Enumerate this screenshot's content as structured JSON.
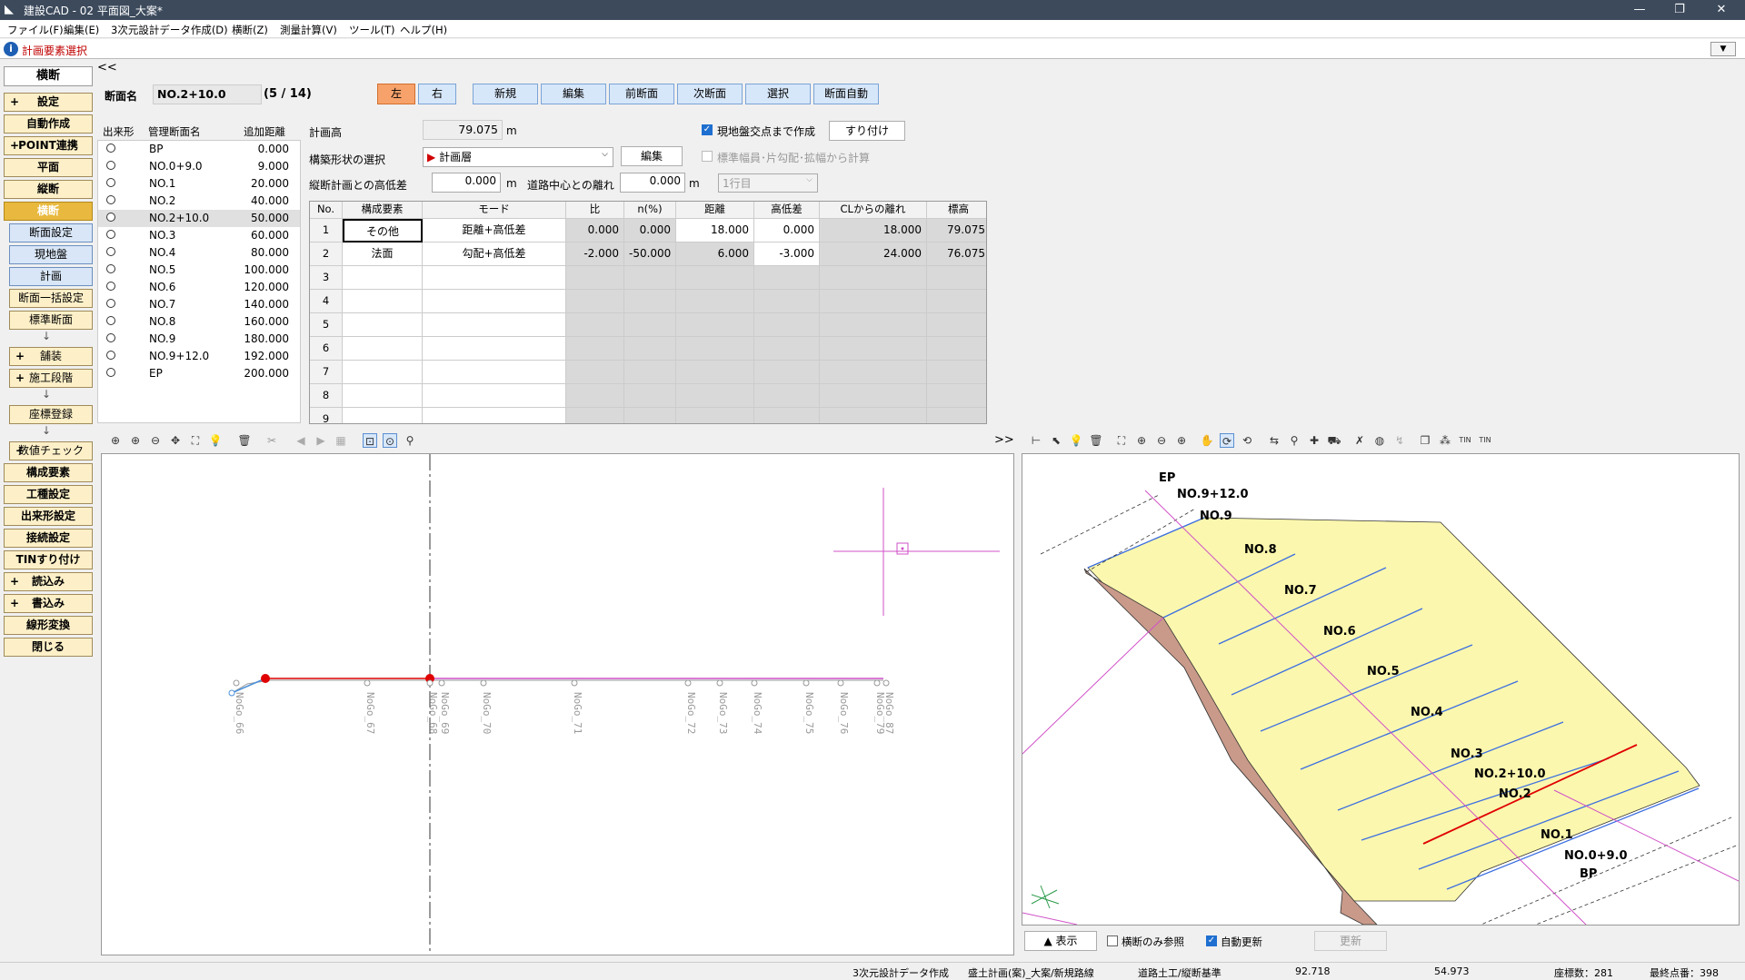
{
  "window": {
    "title": "建設CAD - 02 平面図_大案*",
    "minimize": "—",
    "restore": "❐",
    "close": "✕"
  },
  "menu": [
    "ファイル(F)",
    "編集(E)",
    "3次元設計データ作成(D)",
    "横断(Z)",
    "測量計算(V)",
    "ツール(T)",
    "ヘルプ(H)"
  ],
  "panel": {
    "title": "計画要素選択",
    "collapse": "<<",
    "expand": ">>"
  },
  "sidebar": {
    "tab": "横断",
    "items": [
      {
        "label": "設定",
        "style": "plus"
      },
      {
        "label": "自動作成",
        "style": "main"
      },
      {
        "label": "POINT連携",
        "style": "plus"
      },
      {
        "label": "平面",
        "style": "main"
      },
      {
        "label": "縦断",
        "style": "main"
      },
      {
        "label": "横断",
        "style": "active"
      },
      {
        "label": "断面設定",
        "style": "sub"
      },
      {
        "label": "現地盤",
        "style": "sub"
      },
      {
        "label": "計画",
        "style": "sub"
      },
      {
        "label": "断面一括設定",
        "style": "sub2"
      },
      {
        "label": "標準断面",
        "style": "sub2"
      },
      {
        "label": "↓",
        "style": "arrow"
      },
      {
        "label": "舗装",
        "style": "sub2plus"
      },
      {
        "label": "施工段階",
        "style": "sub2plus"
      },
      {
        "label": "↓",
        "style": "arrow"
      },
      {
        "label": "座標登録",
        "style": "sub2"
      },
      {
        "label": "↓",
        "style": "arrow"
      },
      {
        "label": "数値チェック",
        "style": "sub2plus"
      },
      {
        "label": "構成要素",
        "style": "main"
      },
      {
        "label": "工種設定",
        "style": "main"
      },
      {
        "label": "出来形設定",
        "style": "main"
      },
      {
        "label": "接続設定",
        "style": "main"
      },
      {
        "label": "TINすり付け",
        "style": "main"
      },
      {
        "label": "読込み",
        "style": "plus"
      },
      {
        "label": "書込み",
        "style": "plus"
      },
      {
        "label": "線形変換",
        "style": "main"
      },
      {
        "label": "閉じる",
        "style": "main"
      }
    ]
  },
  "header": {
    "section_label": "断面名",
    "section_value": "NO.2+10.0",
    "count": "(5 / 14)",
    "side_left": "左",
    "side_right": "右",
    "buttons": [
      "新規",
      "編集",
      "前断面",
      "次断面",
      "選択",
      "断面自動"
    ]
  },
  "seclist": {
    "headers": [
      "出来形",
      "管理断面名",
      "追加距離"
    ],
    "rows": [
      {
        "name": "BP",
        "dist": "0.000"
      },
      {
        "name": "NO.0+9.0",
        "dist": "9.000"
      },
      {
        "name": "NO.1",
        "dist": "20.000"
      },
      {
        "name": "NO.2",
        "dist": "40.000"
      },
      {
        "name": "NO.2+10.0",
        "dist": "50.000",
        "selected": true
      },
      {
        "name": "NO.3",
        "dist": "60.000"
      },
      {
        "name": "NO.4",
        "dist": "80.000"
      },
      {
        "name": "NO.5",
        "dist": "100.000"
      },
      {
        "name": "NO.6",
        "dist": "120.000"
      },
      {
        "name": "NO.7",
        "dist": "140.000"
      },
      {
        "name": "NO.8",
        "dist": "160.000"
      },
      {
        "name": "NO.9",
        "dist": "180.000"
      },
      {
        "name": "NO.9+12.0",
        "dist": "192.000"
      },
      {
        "name": "EP",
        "dist": "200.000"
      }
    ]
  },
  "plan": {
    "height_label": "計画高",
    "height_value": "79.075",
    "unit_m": "m",
    "shape_label": "構築形状の選択",
    "shape_value": "計画層",
    "edit_btn": "編集",
    "vdiff_label": "縦断計画との高低差",
    "vdiff_value": "0.000",
    "cl_label": "道路中心との離れ",
    "cl_value": "0.000",
    "row_select": "1行目",
    "chk_ground": "現地盤交点まで作成",
    "chk_ground_checked": true,
    "btn_fit": "すり付け",
    "chk_standard": "標準幅員･片勾配･拡幅から計算",
    "chk_standard_checked": false
  },
  "grid": {
    "headers": [
      "No.",
      "構成要素",
      "モード",
      "比",
      "n(%)",
      "距離",
      "高低差",
      "CLからの離れ",
      "標高"
    ],
    "rows": [
      {
        "no": "1",
        "elem": "その他",
        "mode": "距離+高低差",
        "ratio": "0.000",
        "n": "0.000",
        "dist": "18.000",
        "dh": "0.000",
        "cl": "18.000",
        "elev": "79.075"
      },
      {
        "no": "2",
        "elem": "法面",
        "mode": "勾配+高低差",
        "ratio": "-2.000",
        "n": "-50.000",
        "dist": "6.000",
        "dh": "-3.000",
        "cl": "24.000",
        "elev": "76.075"
      },
      {
        "no": "3"
      },
      {
        "no": "4"
      },
      {
        "no": "5"
      },
      {
        "no": "6"
      },
      {
        "no": "7"
      },
      {
        "no": "8"
      },
      {
        "no": "9"
      }
    ]
  },
  "cross_section": {
    "labels": [
      "NoGo_66",
      "NoGo_67",
      "NoGo_68",
      "NoGo_69",
      "NoGo_70",
      "NoGo_71",
      "NoGo_72",
      "NoGo_73",
      "NoGo_74",
      "NoGo_75",
      "NoGo_76",
      "NoGo_79",
      "NoGo_87"
    ]
  },
  "view3d": {
    "stations": [
      "EP",
      "NO.9+12.0",
      "NO.9",
      "NO.8",
      "NO.7",
      "NO.6",
      "NO.5",
      "NO.4",
      "NO.3",
      "NO.2+10.0",
      "NO.2",
      "NO.1",
      "NO.0+9.0",
      "BP"
    ],
    "btn_show": "▲ 表示",
    "chk_cross_only": "横断のみ参照",
    "chk_cross_only_checked": false,
    "chk_auto": "自動更新",
    "chk_auto_checked": true,
    "btn_update": "更新"
  },
  "status": {
    "items": [
      "3次元設計データ作成",
      "盛土計画(案)_大案/新規路線",
      "道路土工/縦断基準",
      "92.718",
      "54.973",
      "座標数：281",
      "最終点番：398"
    ]
  },
  "colors": {
    "accent": "#e8b93e",
    "plan_line": "#e00000",
    "pink": "#d050c8",
    "surface": "#fbf7ae",
    "slope": "#c99a8a",
    "blue": "#3c6fe0"
  }
}
